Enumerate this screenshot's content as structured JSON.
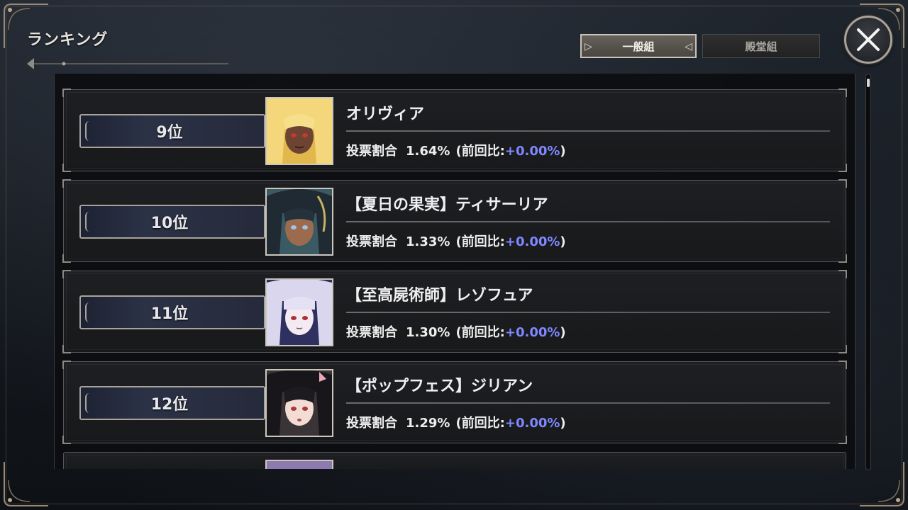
{
  "screen": {
    "title": "ランキング"
  },
  "tabs": [
    {
      "label": "一般組",
      "active": true
    },
    {
      "label": "殿堂組",
      "active": false
    }
  ],
  "close": {
    "icon": "close-icon"
  },
  "labels": {
    "vote_share": "投票割合",
    "prev_prefix": "(前回比:",
    "prev_suffix": ")"
  },
  "colors": {
    "delta": "#7f88ff",
    "rank_plate": "#2c3246"
  },
  "rows": [
    {
      "rank": "9位",
      "name": "オリヴィア",
      "share": "1.64%",
      "delta": "+0.00%",
      "portrait": "blonde-character-portrait"
    },
    {
      "rank": "10位",
      "name": "【夏日の果実】ティサーリア",
      "share": "1.33%",
      "delta": "+0.00%",
      "portrait": "dark-haired-character-portrait"
    },
    {
      "rank": "11位",
      "name": "【至高屍術師】レゾフュア",
      "share": "1.30%",
      "delta": "+0.00%",
      "portrait": "silver-haired-character-portrait"
    },
    {
      "rank": "12位",
      "name": "【ポップフェス】ジリアン",
      "share": "1.29%",
      "delta": "+0.00%",
      "portrait": "black-haired-character-portrait"
    }
  ]
}
